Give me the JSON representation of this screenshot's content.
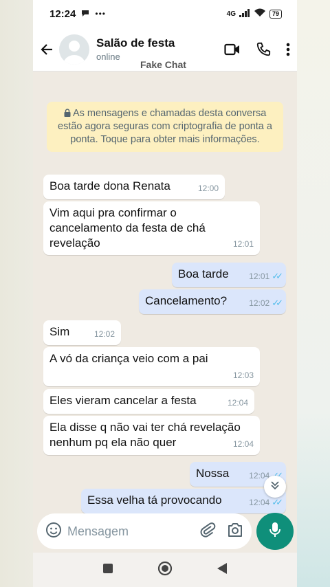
{
  "status_bar": {
    "time": "12:24",
    "network": "4G",
    "battery": "79"
  },
  "header": {
    "contact_name": "Salão de festa",
    "contact_status": "online",
    "overlay_label": "Fake Chat"
  },
  "encryption_notice": "As mensagens e chamadas desta conversa estão agora seguras com criptografia de ponta a ponta. Toque para obter mais informações.",
  "messages": [
    {
      "dir": "in",
      "text": "Boa tarde dona Renata",
      "time": "12:00"
    },
    {
      "dir": "in",
      "text": "Vim aqui pra confirmar o cancelamento da festa de chá revelação",
      "time": "12:01"
    },
    {
      "dir": "out",
      "text": "Boa tarde",
      "time": "12:01"
    },
    {
      "dir": "out",
      "text": "Cancelamento?",
      "time": "12:02"
    },
    {
      "dir": "in",
      "text": "Sim",
      "time": "12:02"
    },
    {
      "dir": "in",
      "text": "A vó da criança veio com a pai",
      "time": "12:03"
    },
    {
      "dir": "in",
      "text": "Eles vieram cancelar a festa",
      "time": "12:04"
    },
    {
      "dir": "in",
      "text": "Ela disse q não vai ter chá revelação nenhum pq ela não quer",
      "time": "12:04"
    },
    {
      "dir": "out",
      "text": "Nossa",
      "time": "12:04"
    },
    {
      "dir": "out",
      "text": "Essa velha tá provocando",
      "time": "12:04"
    }
  ],
  "input": {
    "placeholder": "Mensagem",
    "value": ""
  },
  "colors": {
    "accent": "#0f8f7a",
    "incoming_bubble": "#ffffff",
    "outgoing_bubble": "#dbe6fb",
    "notice_bg": "#fdf0c0",
    "read_ticks": "#53bdeb"
  },
  "icons": [
    "back-arrow-icon",
    "video-call-icon",
    "phone-icon",
    "more-options-icon",
    "lock-icon",
    "emoji-icon",
    "attach-icon",
    "camera-icon",
    "mic-icon",
    "scroll-down-icon",
    "nav-recent-icon",
    "nav-home-icon",
    "nav-back-icon"
  ]
}
